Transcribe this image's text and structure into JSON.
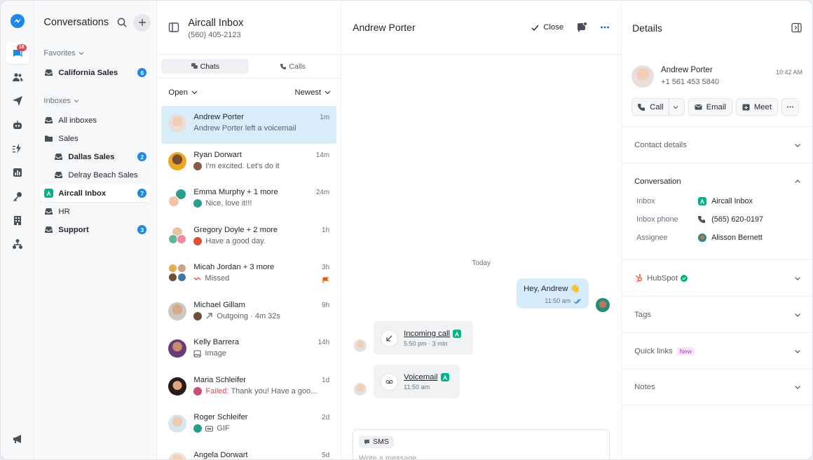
{
  "rail": {
    "badge": "18"
  },
  "sidebar": {
    "title": "Conversations",
    "favorites_label": "Favorites",
    "inboxes_label": "Inboxes",
    "favorites": [
      {
        "label": "California Sales",
        "count": "6"
      }
    ],
    "inboxes": [
      {
        "label": "All inboxes",
        "count": ""
      },
      {
        "label": "Sales",
        "count": ""
      },
      {
        "label": "Dallas Sales",
        "count": "2"
      },
      {
        "label": "Delray Beach Sales",
        "count": ""
      },
      {
        "label": "Aircall Inbox",
        "count": "7"
      },
      {
        "label": "HR",
        "count": ""
      },
      {
        "label": "Support",
        "count": "3"
      }
    ]
  },
  "list": {
    "title": "Aircall Inbox",
    "phone": "(560) 405-2123",
    "tab_chats": "Chats",
    "tab_calls": "Calls",
    "filter_status": "Open",
    "filter_sort": "Newest",
    "items": [
      {
        "name": "Andrew Porter",
        "preview": "Andrew Porter left a voicemail",
        "time": "1m"
      },
      {
        "name": "Ryan Dorwart",
        "preview": "I'm excited. Let's do it",
        "time": "14m"
      },
      {
        "name": "Emma Murphy + 1 more",
        "preview": "Nice, love it!!!",
        "time": "24m"
      },
      {
        "name": "Gregory Doyle + 2 more",
        "preview": "Have a good day.",
        "time": "1h"
      },
      {
        "name": "Micah Jordan + 3 more",
        "preview": "Missed",
        "time": "3h"
      },
      {
        "name": "Michael Gillam",
        "preview": "Outgoing · 4m 32s",
        "time": "9h"
      },
      {
        "name": "Kelly Barrera",
        "preview": "Image",
        "time": "14h"
      },
      {
        "name": "Maria Schleifer",
        "failed": "Failed:",
        "preview": "Thank you! Have a goo...",
        "time": "1d"
      },
      {
        "name": "Roger Schleifer",
        "preview": "GIF",
        "time": "2d"
      },
      {
        "name": "Angela Dorwart",
        "preview": "",
        "time": "5d"
      }
    ]
  },
  "chat": {
    "title": "Andrew Porter",
    "close_label": "Close",
    "today": "Today",
    "outgoing_text": "Hey, Andrew 👋",
    "outgoing_time": "11:50 am",
    "incoming_call_title": "Incoming call",
    "incoming_call_meta": "5:50 pm · 3 min",
    "voicemail_title": "Voicemail",
    "voicemail_meta": "11:50 am",
    "composer_channel": "SMS",
    "composer_placeholder": "Write a message"
  },
  "details": {
    "title": "Details",
    "contact_name": "Andrew Porter",
    "contact_phone": "+1 561 453 5840",
    "contact_time": "10:42 AM",
    "btn_call": "Call",
    "btn_email": "Email",
    "btn_meet": "Meet",
    "sec_contact": "Contact details",
    "sec_conversation": "Conversation",
    "inbox_key": "Inbox",
    "inbox_val": "Aircall Inbox",
    "inbox_phone_key": "Inbox phone",
    "inbox_phone_val": "(565) 620-0197",
    "assignee_key": "Assignee",
    "assignee_val": "Alisson Bernett",
    "sec_hubspot": "HubSpot",
    "sec_tags": "Tags",
    "sec_quicklinks": "Quick links",
    "new_tag": "New",
    "sec_notes": "Notes"
  },
  "colors": {
    "accent": "#1e88e5",
    "aircall_green": "#00b388",
    "active_row": "#d9edfb",
    "failed": "#e5484d"
  }
}
